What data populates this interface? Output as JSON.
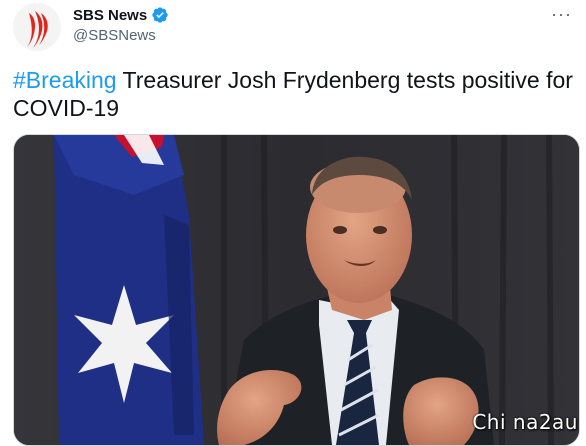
{
  "account": {
    "display_name": "SBS News",
    "handle": "@SBSNews",
    "verified": true,
    "verified_color": "#1d9bf0",
    "avatar_icon": "sbs-logo-icon"
  },
  "menu": {
    "more_label": "···"
  },
  "tweet": {
    "hashtag": "#Breaking",
    "body": " Treasurer Josh Frydenberg tests positive for COVID-19",
    "hashtag_color": "#1d9bf0"
  },
  "media": {
    "watermark": "Chi na2au"
  }
}
